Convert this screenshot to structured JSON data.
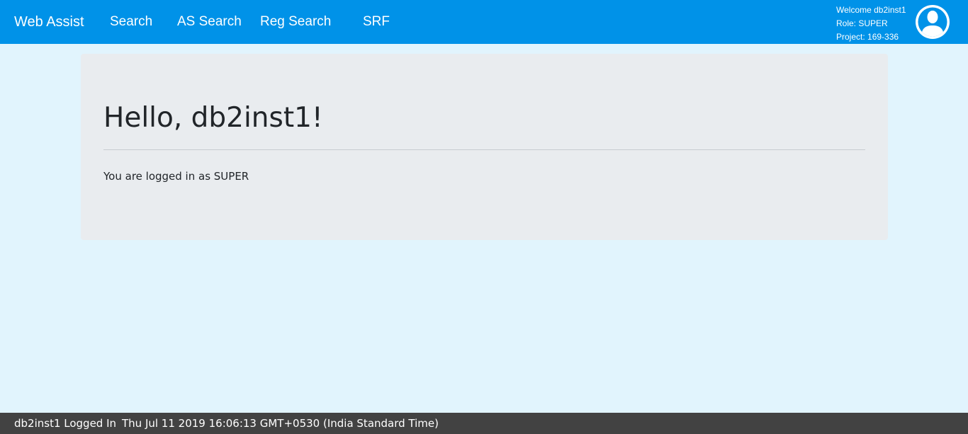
{
  "navbar": {
    "brand": "Web Assist",
    "links": [
      "Search",
      "AS Search",
      "Reg Search",
      "SRF"
    ],
    "user": {
      "welcome": "Welcome db2inst1",
      "role": "Role: SUPER",
      "project": "Project: 169-336"
    },
    "avatar_icon": "user-avatar-icon",
    "background_color": "#0092e8"
  },
  "main": {
    "greeting": "Hello, db2inst1!",
    "message": "You are logged in as SUPER"
  },
  "footer": {
    "status": "db2inst1 Logged In",
    "timestamp": "Thu Jul 11 2019 16:06:13 GMT+0530 (India Standard Time)"
  }
}
